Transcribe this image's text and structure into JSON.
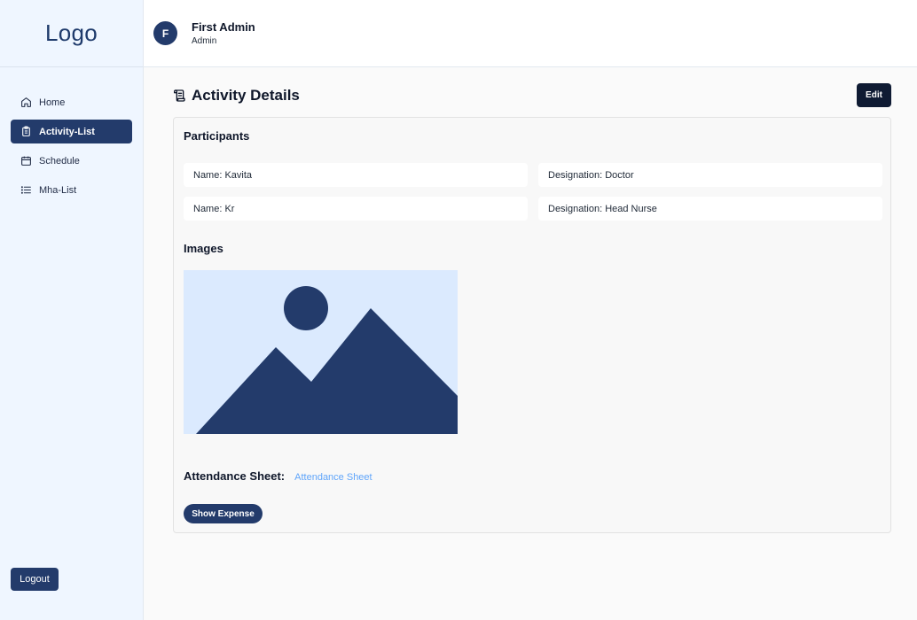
{
  "sidebar": {
    "logo": "Logo",
    "items": [
      {
        "label": "Home",
        "icon": "home-icon"
      },
      {
        "label": "Activity-List",
        "icon": "clipboard-icon",
        "active": true
      },
      {
        "label": "Schedule",
        "icon": "calendar-icon"
      },
      {
        "label": "Mha-List",
        "icon": "list-icon"
      }
    ],
    "logout_label": "Logout"
  },
  "header": {
    "avatar_initial": "F",
    "user_name": "First Admin",
    "user_role": "Admin"
  },
  "main": {
    "title": "Activity Details",
    "title_icon": "scroll-icon",
    "edit_label": "Edit",
    "participants_title": "Participants",
    "participants": [
      {
        "name": "Name: Kavita",
        "designation": "Designation: Doctor"
      },
      {
        "name": "Name: Kr",
        "designation": "Designation: Head Nurse"
      }
    ],
    "images_title": "Images",
    "image_placeholder_icon": "image-placeholder-icon",
    "attendance_label": "Attendance Sheet:",
    "attendance_link": "Attendance Sheet",
    "show_expense_label": "Show Expense"
  },
  "colors": {
    "primary": "#233b6b",
    "sidebar_bg": "#eff6ff",
    "link": "#60a5fa",
    "edit_button": "#0f1b33",
    "image_bg": "#dbeafe"
  }
}
